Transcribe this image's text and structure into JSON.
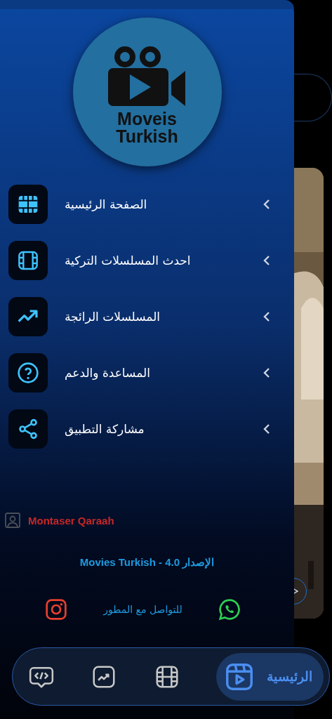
{
  "logo": {
    "line_1": "Moveis",
    "line_2": "Turkish"
  },
  "menu": [
    {
      "kind": "grid",
      "label": "الصفحة الرئيسية"
    },
    {
      "kind": "film",
      "label": "احدث المسلسلات التركية"
    },
    {
      "kind": "trending",
      "label": "المسلسلات الرائجة"
    },
    {
      "kind": "help",
      "label": "المساعدة والدعم"
    },
    {
      "kind": "share",
      "label": "مشاركة التطبيق"
    }
  ],
  "developer": "Montaser Qaraah",
  "version": "الإصدار 4.0 - Movies Turkish",
  "contact": "للتواصل مع المطور",
  "nav": [
    {
      "kind": "code",
      "selected": false
    },
    {
      "kind": "trending",
      "selected": false
    },
    {
      "kind": "film",
      "selected": false
    },
    {
      "kind": "reels",
      "selected": true,
      "label": "الرئيسية"
    }
  ]
}
